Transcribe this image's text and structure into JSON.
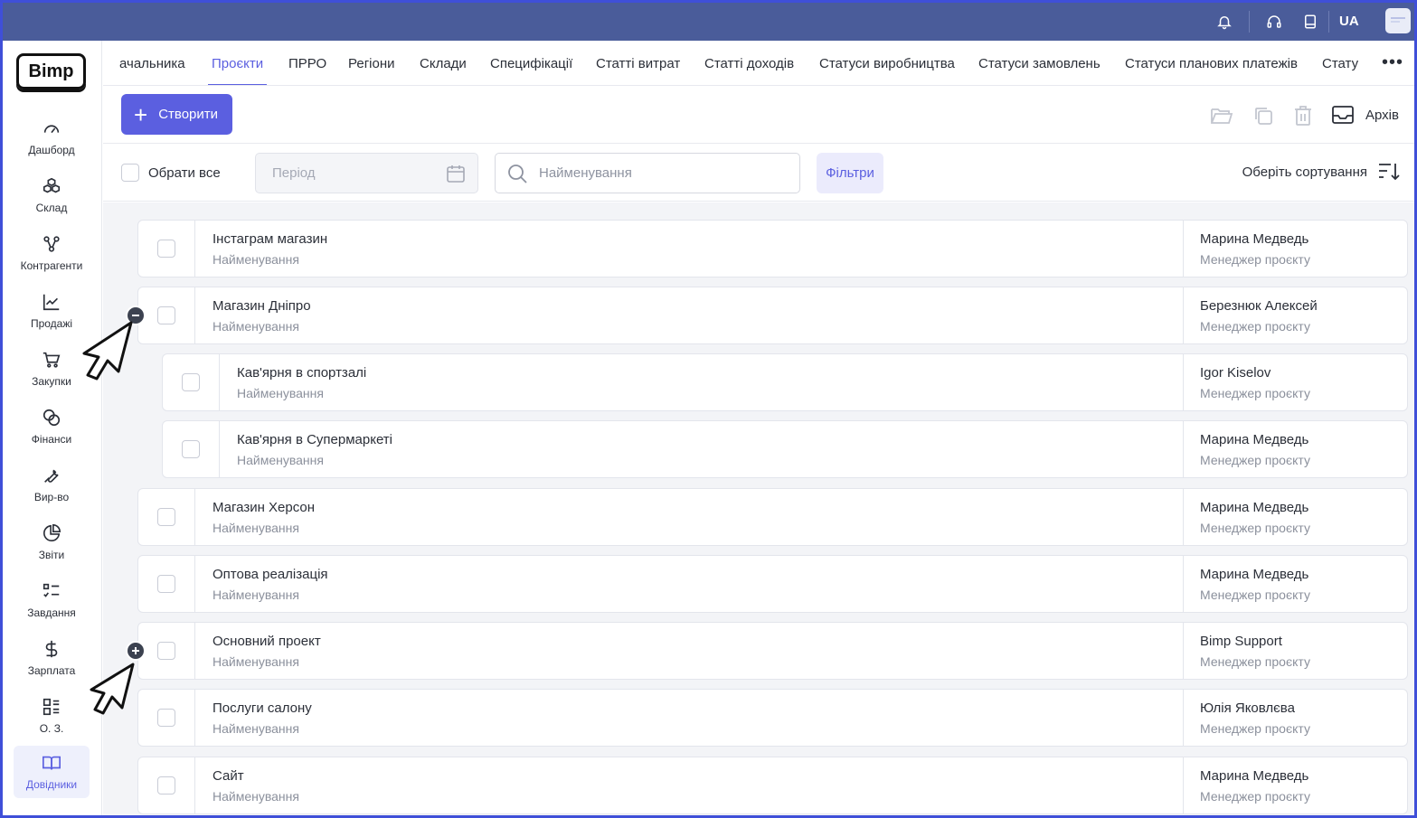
{
  "topbar": {
    "icons": [
      "bell-icon",
      "headset-icon",
      "book-icon"
    ],
    "language": "UA",
    "avatar": "user-avatar"
  },
  "sidebar": {
    "logo": "Bimp",
    "items": [
      {
        "label": "Дашборд",
        "icon": "gauge-icon"
      },
      {
        "label": "Склад",
        "icon": "boxes-icon"
      },
      {
        "label": "Контрагенти",
        "icon": "people-graph-icon"
      },
      {
        "label": "Продажі",
        "icon": "chart-line-icon"
      },
      {
        "label": "Закупки",
        "icon": "cart-icon"
      },
      {
        "label": "Фінанси",
        "icon": "coins-icon"
      },
      {
        "label": "Вир-во",
        "icon": "wrench-icon"
      },
      {
        "label": "Звіти",
        "icon": "pie-chart-icon"
      },
      {
        "label": "Завдання",
        "icon": "task-list-icon"
      },
      {
        "label": "Зарплата",
        "icon": "dollar-icon"
      },
      {
        "label": "О. З.",
        "icon": "grid-list-icon"
      },
      {
        "label": "Довідники",
        "icon": "open-book-icon",
        "active": true
      }
    ]
  },
  "tabs": [
    {
      "label": "ачальника"
    },
    {
      "label": "Проєкти",
      "active": true
    },
    {
      "label": "ПРРО"
    },
    {
      "label": "Регіони"
    },
    {
      "label": "Склади"
    },
    {
      "label": "Специфікації"
    },
    {
      "label": "Статті витрат"
    },
    {
      "label": "Статті доходів"
    },
    {
      "label": "Статуси виробництва"
    },
    {
      "label": "Статуси замовлень"
    },
    {
      "label": "Статуси планових платежів"
    },
    {
      "label": "Стату"
    }
  ],
  "tabs_more": "•••",
  "toolbar": {
    "create_label": "Створити",
    "archive_label": "Архів"
  },
  "filterbar": {
    "select_all_label": "Обрати все",
    "period_placeholder": "Період",
    "search_placeholder": "Найменування",
    "filters_label": "Фільтри",
    "sort_label": "Оберіть сортування"
  },
  "colors": {
    "accent": "#5b5fe0",
    "topbar": "#4a5c9a",
    "frame": "#3f4fd8"
  },
  "rows": [
    {
      "name": "Інстаграм магазин",
      "subtitle": "Найменування",
      "manager": "Марина Медведь",
      "manager_role": "Менеджер проєкту",
      "level": 0
    },
    {
      "name": "Магазин Дніпро",
      "subtitle": "Найменування",
      "manager": "Березнюк Алексей",
      "manager_role": "Менеджер проєкту",
      "level": 0,
      "toggle": "collapse"
    },
    {
      "name": "Кав'ярня в спортзалі",
      "subtitle": "Найменування",
      "manager": "Igor Kiselov",
      "manager_role": "Менеджер проєкту",
      "level": 1
    },
    {
      "name": "Кав'ярня в Супермаркеті",
      "subtitle": "Найменування",
      "manager": "Марина Медведь",
      "manager_role": "Менеджер проєкту",
      "level": 1
    },
    {
      "name": "Магазин Херсон",
      "subtitle": "Найменування",
      "manager": "Марина Медведь",
      "manager_role": "Менеджер проєкту",
      "level": 0
    },
    {
      "name": "Оптова реалізація",
      "subtitle": "Найменування",
      "manager": "Марина Медведь",
      "manager_role": "Менеджер проєкту",
      "level": 0
    },
    {
      "name": "Основний проект",
      "subtitle": "Найменування",
      "manager": "Bimp Support",
      "manager_role": "Менеджер проєкту",
      "level": 0,
      "toggle": "expand"
    },
    {
      "name": "Послуги салону",
      "subtitle": "Найменування",
      "manager": "Юлія Яковлєва",
      "manager_role": "Менеджер проєкту",
      "level": 0
    },
    {
      "name": "Сайт",
      "subtitle": "Найменування",
      "manager": "Марина Медведь",
      "manager_role": "Менеджер проєкту",
      "level": 0
    }
  ]
}
